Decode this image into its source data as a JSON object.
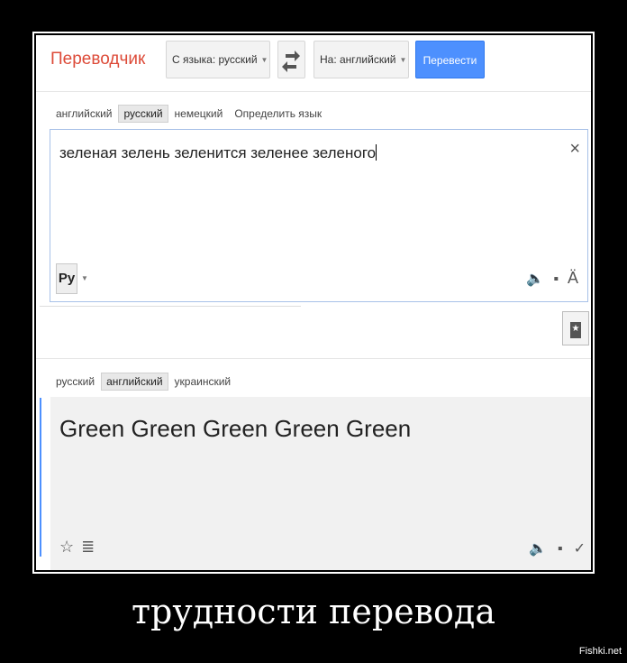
{
  "header": {
    "brand": "Переводчик",
    "from_label": "С языка: русский",
    "to_label": "На: английский",
    "translate_label": "Перевести"
  },
  "source": {
    "tabs": [
      "английский",
      "русский",
      "немецкий",
      "Определить язык"
    ],
    "active_tab": "русский",
    "text": "зеленая зелень зеленится зеленее зеленого",
    "ime_label": "Ру"
  },
  "target": {
    "tabs": [
      "русский",
      "английский",
      "украинский"
    ],
    "active_tab": "английский",
    "text": "Green Green Green Green Green"
  },
  "caption": "трудности перевода",
  "watermark": "Fishki.net",
  "colors": {
    "brand": "#dd4b39",
    "translate_button": "#4d90fe",
    "focus_border": "#a8c1e8"
  }
}
